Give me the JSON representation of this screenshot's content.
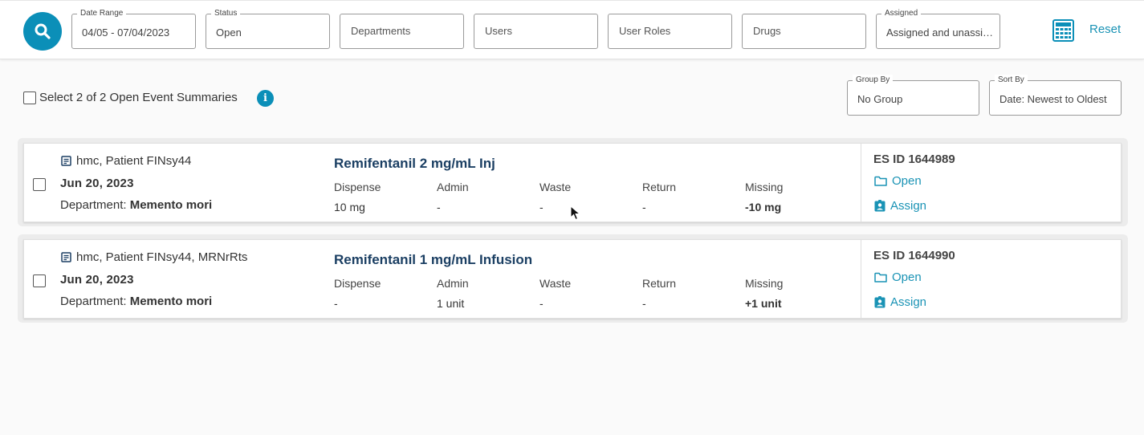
{
  "colors": {
    "accent": "#0b8fb8",
    "link": "#1a93b5",
    "drug_title": "#1b3f63"
  },
  "filters": {
    "date_range": {
      "label": "Date Range",
      "value": "04/05 - 07/04/2023"
    },
    "status": {
      "label": "Status",
      "value": "Open"
    },
    "departments": {
      "placeholder": "Departments"
    },
    "users": {
      "placeholder": "Users"
    },
    "user_roles": {
      "placeholder": "User Roles"
    },
    "drugs": {
      "placeholder": "Drugs"
    },
    "assigned": {
      "label": "Assigned",
      "value": "Assigned and unassigned"
    },
    "reset_label": "Reset",
    "search_icon": "search-icon",
    "calculator_icon": "calculator-icon"
  },
  "list_header": {
    "select_all_text": "Select 2 of 2 Open Event Summaries",
    "info_icon": "i",
    "group_by": {
      "label": "Group By",
      "value": "No Group"
    },
    "sort_by": {
      "label": "Sort By",
      "value": "Date: Newest to Oldest"
    }
  },
  "columns": [
    "Dispense",
    "Admin",
    "Waste",
    "Return",
    "Missing"
  ],
  "events": [
    {
      "patient": "hmc, Patient FINsy44",
      "date": "Jun 20, 2023",
      "department_label": "Department:",
      "department": "Memento mori",
      "drug": "Remifentanil 2 mg/mL Inj",
      "values": [
        "10 mg",
        "-",
        "-",
        "-",
        "-10 mg"
      ],
      "es_id": "ES ID 1644989",
      "open_label": "Open",
      "assign_label": "Assign"
    },
    {
      "patient": "hmc, Patient FINsy44, MRNrRts",
      "date": "Jun 20, 2023",
      "department_label": "Department:",
      "department": "Memento mori",
      "drug": "Remifentanil 1 mg/mL Infusion",
      "values": [
        "-",
        "1 unit",
        "-",
        "-",
        "+1 unit"
      ],
      "es_id": "ES ID 1644990",
      "open_label": "Open",
      "assign_label": "Assign"
    }
  ]
}
